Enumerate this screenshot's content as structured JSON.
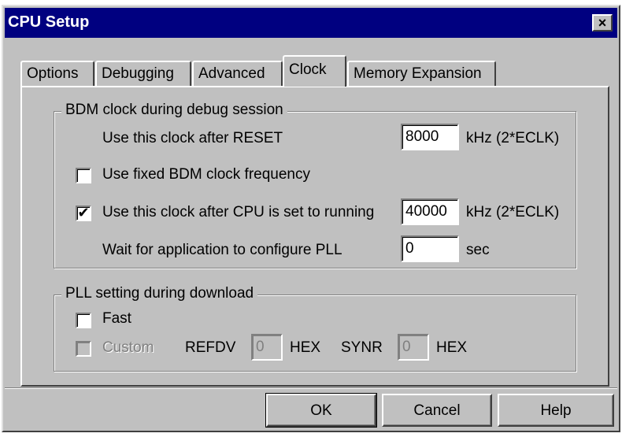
{
  "window": {
    "title": "CPU Setup",
    "close_glyph": "×"
  },
  "tabs": [
    "Options",
    "Debugging",
    "Advanced",
    "Clock",
    "Memory Expansion"
  ],
  "active_tab": "Clock",
  "bdm_group": {
    "legend": "BDM clock during debug session",
    "reset_label": "Use this clock after RESET",
    "reset_value": "8000",
    "reset_unit": "kHz  (2*ECLK)",
    "fixed_label": "Use fixed BDM clock frequency",
    "fixed_checked": false,
    "running_label": "Use this clock after CPU is set to running",
    "running_checked": true,
    "running_value": "40000",
    "running_unit": "kHz  (2*ECLK)",
    "wait_label": "Wait for application to configure PLL",
    "wait_value": "0",
    "wait_unit": "sec"
  },
  "pll_group": {
    "legend": "PLL setting during download",
    "fast_label": "Fast",
    "fast_checked": false,
    "custom_label": "Custom",
    "custom_checked": false,
    "refdv_label": "REFDV",
    "refdv_value": "0",
    "refdv_unit": "HEX",
    "synr_label": "SYNR",
    "synr_value": "0",
    "synr_unit": "HEX"
  },
  "buttons": {
    "ok": "OK",
    "cancel": "Cancel",
    "help": "Help"
  },
  "check_glyph": "✔"
}
